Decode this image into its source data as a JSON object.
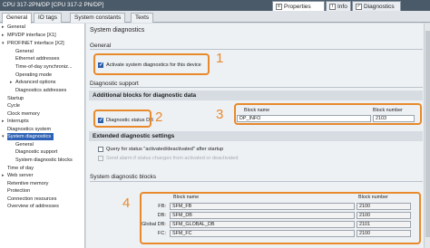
{
  "window": {
    "title": "CPU 317-2PN/DP [CPU 317-2 PN/DP]",
    "panel_tabs": [
      {
        "label": "Properties",
        "icon": "properties-icon",
        "active": true
      },
      {
        "label": "Info",
        "icon": "info-icon",
        "active": false
      },
      {
        "label": "Diagnostics",
        "icon": "diagnostics-icon",
        "active": false
      }
    ]
  },
  "tabs": [
    "General",
    "IO tags",
    "System constants",
    "Texts"
  ],
  "nav": [
    "General",
    "MPI/DP interface [X1]",
    "PROFINET interface [X2]",
    "General",
    "Ethernet addresses",
    "Time-of-day synchroniz...",
    "Operating mode",
    "Advanced options",
    "Diagnostics addresses",
    "Startup",
    "Cycle",
    "Clock memory",
    "Interrupts",
    "Diagnostics system",
    "System diagnostics",
    "General",
    "Diagnostic support",
    "System diagnostic blocks",
    "Time of day",
    "Web server",
    "Retentive memory",
    "Protection",
    "Connection resources",
    "Overview of addresses"
  ],
  "content": {
    "section_title": "System diagnostics",
    "general_heading": "General",
    "activate_label": "Activate system diagnostics for this device",
    "activate_checked": true,
    "diag_support_heading": "Diagnostic support",
    "additional_blocks_heading": "Additional blocks for diagnostic data",
    "diag_status_db_label": "Diagnostic status DB",
    "diag_status_db_checked": true,
    "block_name_header": "Block name",
    "block_number_header": "Block number",
    "diag_block_name": "DP_INFO",
    "diag_block_number": "2103",
    "extended_heading": "Extended diagnostic settings",
    "query_status_label": "Query for status \"activated/deactivated\" after startup",
    "send_alarm_label": "Send alarm if status changes from activated or deactivated",
    "sys_blocks_title": "System diagnostic blocks",
    "sys_blocks": [
      {
        "label": "FB:",
        "name": "SFM_FB",
        "number": "2100"
      },
      {
        "label": "DB:",
        "name": "SFM_DB",
        "number": "2100"
      },
      {
        "label": "Global DB:",
        "name": "SFM_GLOBAL_DB",
        "number": "2101"
      },
      {
        "label": "FC:",
        "name": "SFM_FC",
        "number": "2100"
      }
    ]
  },
  "callouts": [
    "1",
    "2",
    "3",
    "4"
  ],
  "colors": {
    "callout": "#e8892b",
    "selection": "#2f62b4",
    "titlebar": "#4b5a69"
  }
}
